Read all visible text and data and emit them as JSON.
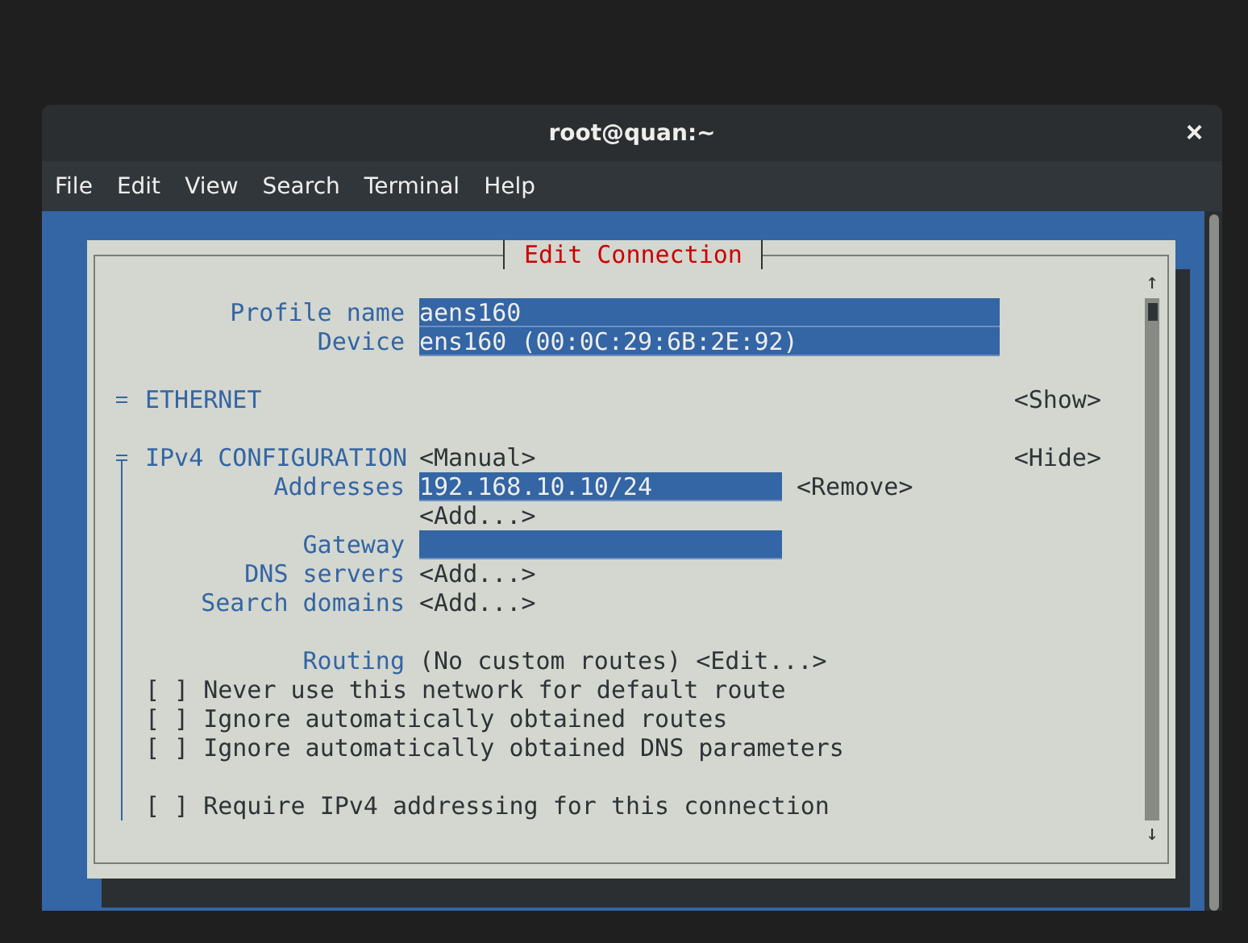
{
  "window": {
    "title": "root@quan:~",
    "close": "×"
  },
  "menu": [
    "File",
    "Edit",
    "View",
    "Search",
    "Terminal",
    "Help"
  ],
  "dialog": {
    "title": "Edit Connection",
    "fields": [
      {
        "label": "Profile name",
        "value": "aens160"
      },
      {
        "label": "Device",
        "value": "ens160 (00:0C:29:6B:2E:92)"
      }
    ],
    "sections": [
      {
        "title": "ETHERNET",
        "toggle": "<Show>",
        "expanded": false
      },
      {
        "title": "IPv4 CONFIGURATION",
        "mode": "<Manual>",
        "toggle": "<Hide>",
        "expanded": true,
        "rows": [
          {
            "kind": "list",
            "label": "Addresses",
            "items": [
              {
                "value": "192.168.10.10/24",
                "action": "<Remove>"
              }
            ],
            "add": "<Add...>"
          },
          {
            "kind": "field",
            "label": "Gateway"
          },
          {
            "kind": "list",
            "label": "DNS servers",
            "add": "<Add...>"
          },
          {
            "kind": "list",
            "label": "Search domains",
            "add": "<Add...>"
          }
        ],
        "routing": {
          "label": "Routing",
          "value": "(No custom routes)",
          "action": "<Edit...>"
        },
        "options": [
          {
            "box": "[ ]",
            "label": "Never use this network for default route",
            "checked": false
          },
          {
            "box": "[ ]",
            "label": "Ignore automatically obtained routes",
            "checked": false
          },
          {
            "box": "[ ]",
            "label": "Ignore automatically obtained DNS parameters",
            "checked": false
          }
        ],
        "require": {
          "box": "[ ]",
          "label": "Require IPv4 addressing for this connection",
          "checked": false
        }
      }
    ],
    "scrollbar": {
      "up": "↑",
      "down": "↓"
    }
  }
}
